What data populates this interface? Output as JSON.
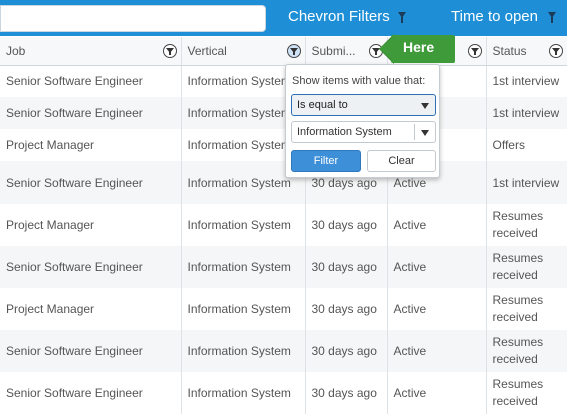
{
  "topbar": {
    "search_value": "",
    "chevron_filters_label": "Chevron Filters",
    "time_to_open_label": "Time to open"
  },
  "columns": [
    {
      "label": "Job",
      "active": false
    },
    {
      "label": "Vertical",
      "active": true
    },
    {
      "label": "Submi...",
      "active": false
    },
    {
      "label": "",
      "active": false
    },
    {
      "label": "Status",
      "active": false
    }
  ],
  "rows": [
    {
      "job": "Senior Software Engineer",
      "vertical": "Information System",
      "submitted": "",
      "state": "",
      "status": "1st interview"
    },
    {
      "job": "Senior Software Engineer",
      "vertical": "Information System",
      "submitted": "",
      "state": "",
      "status": "1st interview"
    },
    {
      "job": "Project Manager",
      "vertical": "Information System",
      "submitted": "",
      "state": "",
      "status": "Offers"
    },
    {
      "job": "Senior Software Engineer",
      "vertical": "Information System",
      "submitted": "30 days ago",
      "state": "Active",
      "status": "1st interview"
    },
    {
      "job": "Project Manager",
      "vertical": "Information System",
      "submitted": "30 days ago",
      "state": "Active",
      "status": "Resumes received"
    },
    {
      "job": "Senior Software Engineer",
      "vertical": "Information System",
      "submitted": "30 days ago",
      "state": "Active",
      "status": "Resumes received"
    },
    {
      "job": "Project Manager",
      "vertical": "Information System",
      "submitted": "30 days ago",
      "state": "Active",
      "status": "Resumes received"
    },
    {
      "job": "Senior Software Engineer",
      "vertical": "Information System",
      "submitted": "30 days ago",
      "state": "Active",
      "status": "Resumes received"
    },
    {
      "job": "Senior Software Engineer",
      "vertical": "Information System",
      "submitted": "30 days ago",
      "state": "Active",
      "status": "Resumes received"
    }
  ],
  "filter_popup": {
    "title": "Show items with value that:",
    "operator": "Is equal to",
    "value": "Information System",
    "filter_label": "Filter",
    "clear_label": "Clear"
  },
  "callout": {
    "text": "Here",
    "color": "#3f9a3a"
  },
  "colors": {
    "topbar": "#1e8fd6",
    "primary_button": "#3d8fd8",
    "active_header": "#cfe3f7"
  }
}
